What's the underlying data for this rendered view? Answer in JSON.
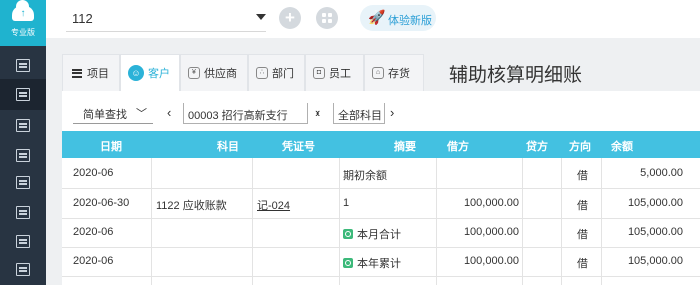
{
  "sidebar": {
    "logo_label": "专业版",
    "items": [
      "ledger-icon",
      "voucher-icon",
      "chart-icon",
      "book-icon",
      "calendar-icon",
      "report-icon",
      "tool-icon",
      "image-icon"
    ]
  },
  "topbar": {
    "company": "112",
    "add_icon": "plus-icon",
    "apps_icon": "grid-icon",
    "try_new_label": "体验新版"
  },
  "tabs": [
    {
      "label": "项目",
      "icon": "list-icon",
      "active": false
    },
    {
      "label": "客户",
      "icon": "customer-icon",
      "active": true
    },
    {
      "label": "供应商",
      "icon": "supplier-icon",
      "active": false
    },
    {
      "label": "部门",
      "icon": "department-icon",
      "active": false
    },
    {
      "label": "员工",
      "icon": "employee-icon",
      "active": false
    },
    {
      "label": "存货",
      "icon": "inventory-icon",
      "active": false
    }
  ],
  "page_title": "辅助核算明细账",
  "filters": {
    "query_mode": "简单查找",
    "entity": "00003  招行高新支行",
    "account": "全部科目"
  },
  "table": {
    "headers": [
      "日期",
      "科目",
      "凭证号",
      "摘要",
      "借方",
      "贷方",
      "方向",
      "余额"
    ],
    "rows": [
      {
        "date": "2020-06",
        "account": "",
        "voucher": "",
        "summary": "期初余额",
        "summary_icon": false,
        "debit": "",
        "credit": "",
        "direction": "借",
        "balance": "5,000.00"
      },
      {
        "date": "2020-06-30",
        "account": "1122 应收账款",
        "voucher": "记-024",
        "summary": "1",
        "summary_icon": false,
        "debit": "100,000.00",
        "credit": "",
        "direction": "借",
        "balance": "105,000.00"
      },
      {
        "date": "2020-06",
        "account": "",
        "voucher": "",
        "summary": "本月合计",
        "summary_icon": true,
        "debit": "100,000.00",
        "credit": "",
        "direction": "借",
        "balance": "105,000.00"
      },
      {
        "date": "2020-06",
        "account": "",
        "voucher": "",
        "summary": "本年累计",
        "summary_icon": true,
        "debit": "100,000.00",
        "credit": "",
        "direction": "借",
        "balance": "105,000.00"
      }
    ]
  },
  "colors": {
    "sidebar": "#283442",
    "accent": "#43c1e1",
    "logo": "#1fb3cf",
    "summary_icon": "#3cb97a"
  }
}
